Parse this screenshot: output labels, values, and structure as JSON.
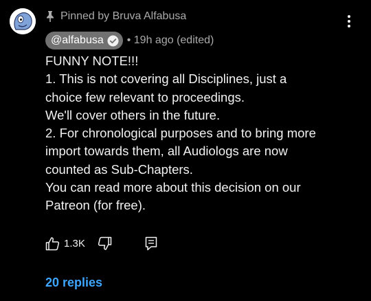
{
  "comment": {
    "pinned_label": "Pinned by Bruva Alfabusa",
    "author_handle": "@alfabusa",
    "timestamp": "• 19h ago (edited)",
    "body_lines": [
      "FUNNY NOTE!!!",
      "1. This is not covering all Disciplines, just a",
      "choice few relevant to proceedings.",
      "We'll cover others in the future.",
      "2. For chronological purposes and to bring more",
      "import towards them, all Audiologs are now",
      "counted as Sub-Chapters.",
      "You can read more about this decision on our",
      "Patreon (for free)."
    ],
    "like_count": "1.3K",
    "replies_label": "20 replies"
  },
  "icons": {
    "pin": "pin-icon",
    "more": "more-vertical-icon",
    "verified": "verified-check-icon",
    "like": "thumbs-up-icon",
    "dislike": "thumbs-down-icon",
    "reply": "reply-comment-icon"
  },
  "colors": {
    "background": "#000000",
    "text": "#f1f1f1",
    "secondary_text": "#aaaaaa",
    "handle_chip": "#717171",
    "replies_link": "#3ea6ff"
  }
}
